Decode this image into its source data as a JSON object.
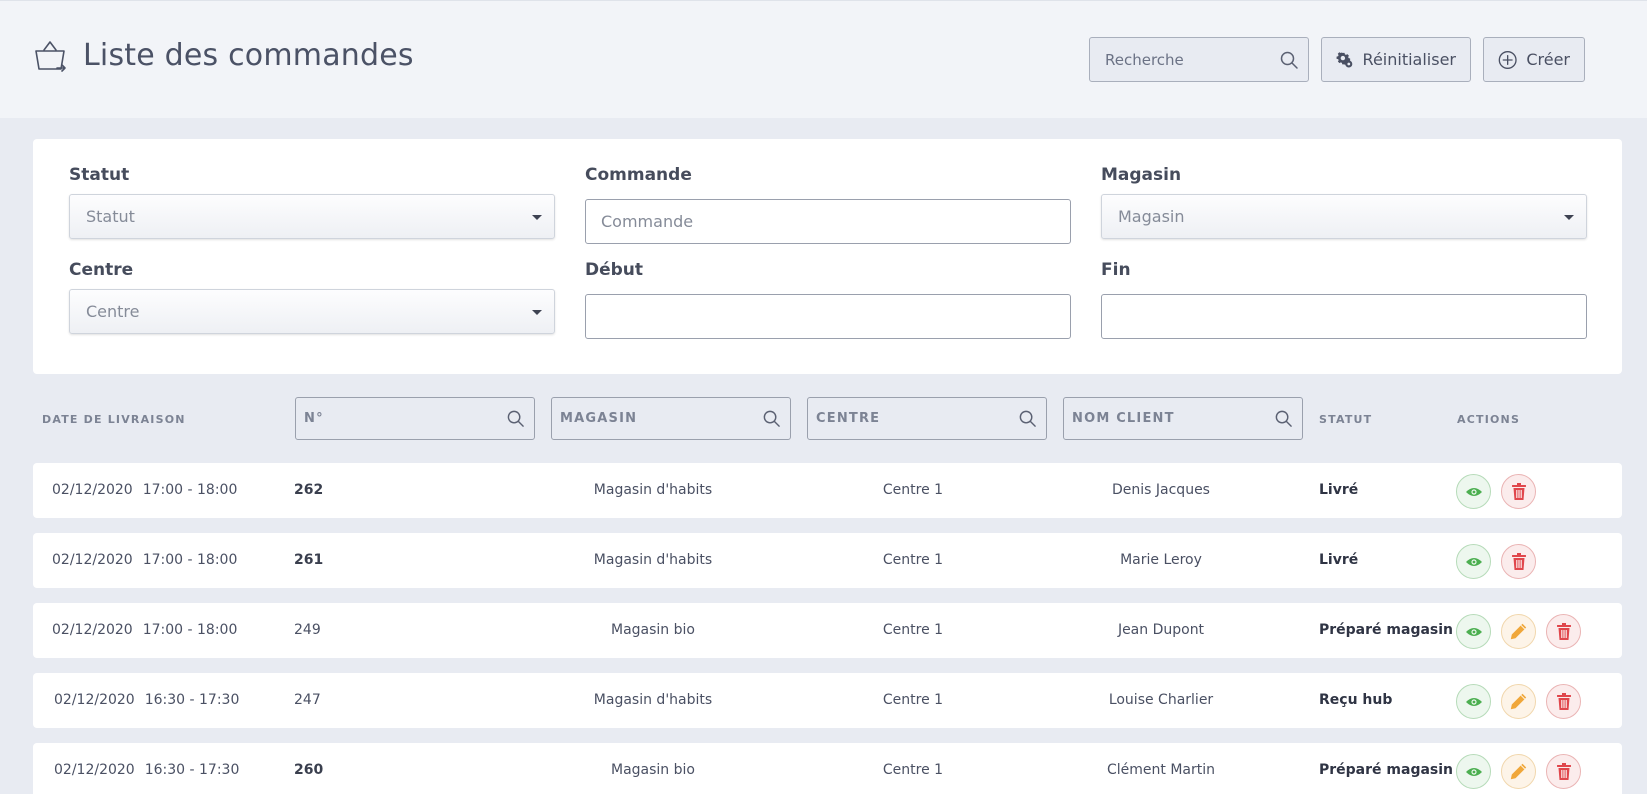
{
  "header": {
    "title": "Liste des commandes",
    "search_placeholder": "Recherche",
    "reset_label": "Réinitialiser",
    "create_label": "Créer"
  },
  "filters": {
    "statut": {
      "label": "Statut",
      "placeholder": "Statut"
    },
    "commande": {
      "label": "Commande",
      "placeholder": "Commande"
    },
    "magasin": {
      "label": "Magasin",
      "placeholder": "Magasin"
    },
    "centre": {
      "label": "Centre",
      "placeholder": "Centre"
    },
    "debut": {
      "label": "Début",
      "value": ""
    },
    "fin": {
      "label": "Fin",
      "value": ""
    }
  },
  "table": {
    "columns": {
      "date": "DATE DE LIVRAISON",
      "num": "N°",
      "magasin": "MAGASIN",
      "centre": "CENTRE",
      "client": "NOM CLIENT",
      "statut": "STATUT",
      "actions": "ACTIONS"
    },
    "rows": [
      {
        "date": "02/12/2020",
        "time": "17:00 - 18:00",
        "num": "262",
        "shop": "Magasin d'habits",
        "centre": "Centre 1",
        "client": "Denis Jacques",
        "status": "Livré"
      },
      {
        "date": "02/12/2020",
        "time": "17:00 - 18:00",
        "num": "261",
        "shop": "Magasin d'habits",
        "centre": "Centre 1",
        "client": "Marie Leroy",
        "status": "Livré"
      },
      {
        "date": "02/12/2020",
        "time": "17:00 - 18:00",
        "num": "249",
        "shop": "Magasin bio",
        "centre": "Centre 1",
        "client": "Jean Dupont",
        "status": "Préparé magasin"
      },
      {
        "date": "02/12/2020",
        "time": "16:30 - 17:30",
        "num": "247",
        "shop": "Magasin d'habits",
        "centre": "Centre 1",
        "client": "Louise Charlier",
        "status": "Reçu hub"
      },
      {
        "date": "02/12/2020",
        "time": "16:30 - 17:30",
        "num": "260",
        "shop": "Magasin bio",
        "centre": "Centre 1",
        "client": "Clément Martin",
        "status": "Préparé magasin"
      }
    ]
  },
  "colors": {
    "page_bg": "#e8ebf2",
    "header_bg": "#f2f4f8",
    "view_green": "#4caf50",
    "edit_orange": "#f0a73a",
    "delete_red": "#e0474c"
  },
  "icons": {
    "title": "basket-icon",
    "search": "search-icon",
    "reset": "gear-icon",
    "create": "plus-circle-icon",
    "view": "eye-icon",
    "edit": "pencil-icon",
    "delete": "trash-icon"
  }
}
